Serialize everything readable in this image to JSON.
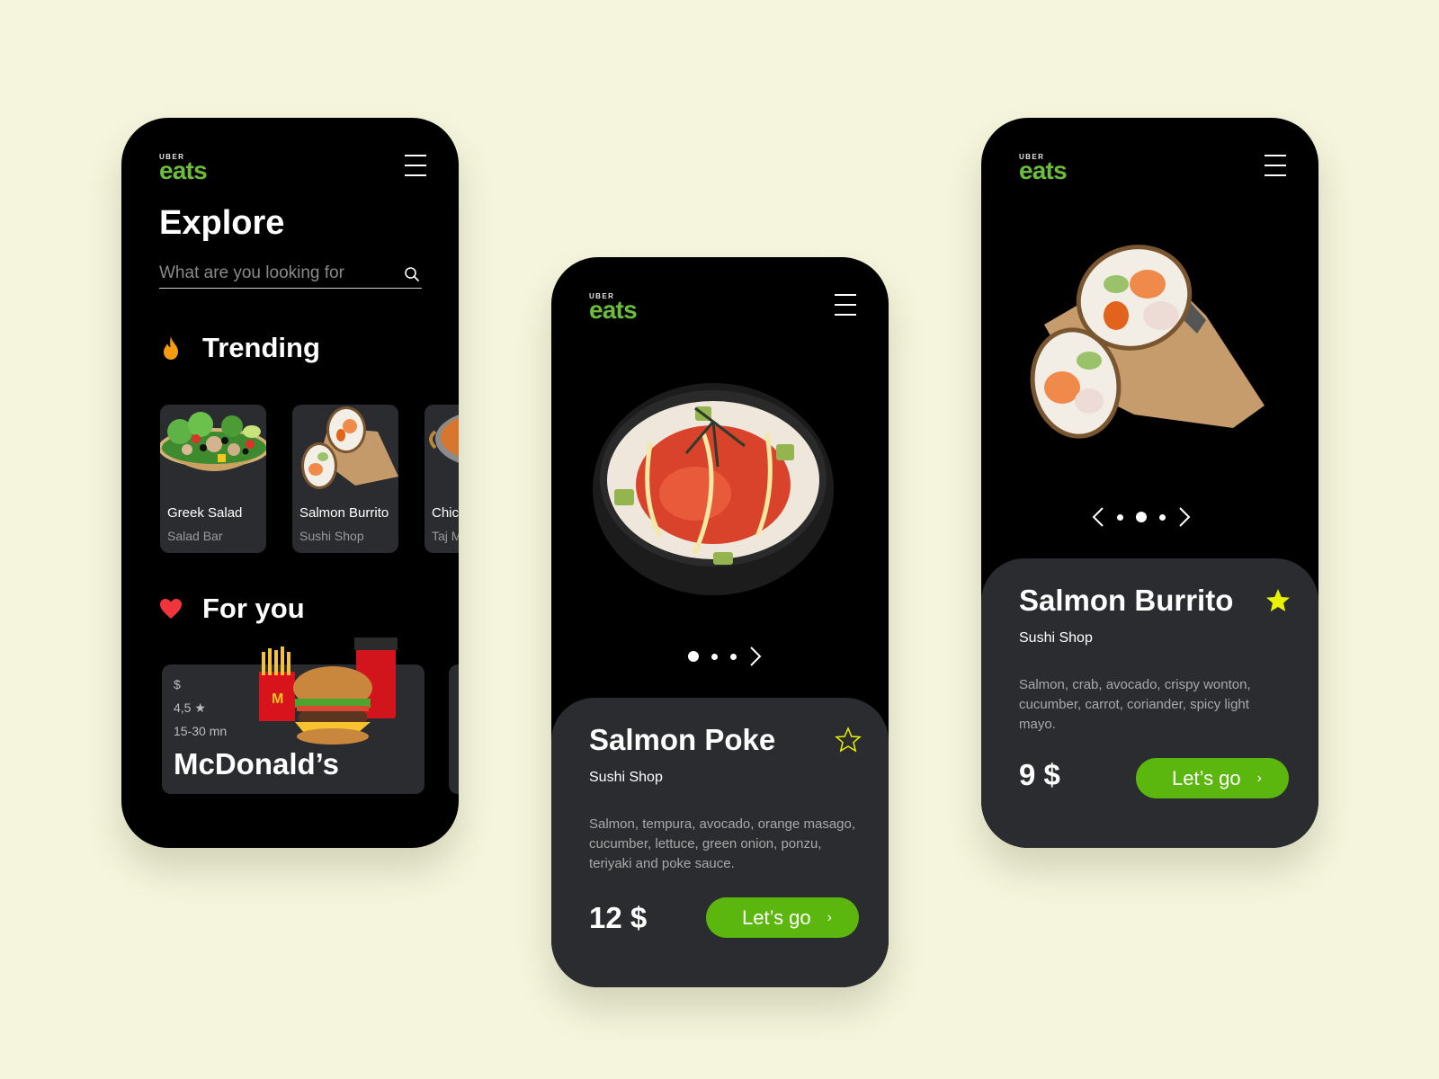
{
  "brand": {
    "uber": "UBER",
    "eats": "eats",
    "accent_color": "#6cbd3c"
  },
  "colors": {
    "background": "#f4f5dc",
    "phone": "#000000",
    "card": "#2b2c2f",
    "button": "#5bb60d",
    "star": "#e6f200",
    "flame": "#f39c12",
    "heart": "#f0353d"
  },
  "explore": {
    "title": "Explore",
    "search": {
      "placeholder": "What are you looking for",
      "value": ""
    },
    "trending": {
      "label": "Trending",
      "icon": "flame-icon",
      "items": [
        {
          "name": "Greek Salad",
          "shop": "Salad Bar"
        },
        {
          "name": "Salmon Burrito",
          "shop": "Sushi Shop"
        },
        {
          "name": "Chicken Curry",
          "shop": "Taj Mahal"
        }
      ]
    },
    "for_you": {
      "label": "For you",
      "icon": "heart-icon",
      "items": [
        {
          "price_level": "$",
          "rating": "4,5 ★",
          "delivery_time": "15-30 mn",
          "name": "McDonald’s"
        }
      ]
    }
  },
  "poke": {
    "name": "Salmon Poke",
    "shop": "Sushi Shop",
    "description": "Salmon, tempura, avocado, orange masago, cucumber, lettuce, green onion, ponzu, teriyaki and poke sauce.",
    "price": "12 $",
    "cta": "Let’s go",
    "favorited": false,
    "carousel": {
      "count": 3,
      "active": 1
    }
  },
  "burrito": {
    "name": "Salmon Burrito",
    "shop": "Sushi Shop",
    "description": "Salmon, crab, avocado, crispy wonton, cucumber, carrot, coriander, spicy light mayo.",
    "price": "9 $",
    "cta": "Let’s go",
    "favorited": true,
    "carousel": {
      "count": 3,
      "active": 2
    }
  }
}
